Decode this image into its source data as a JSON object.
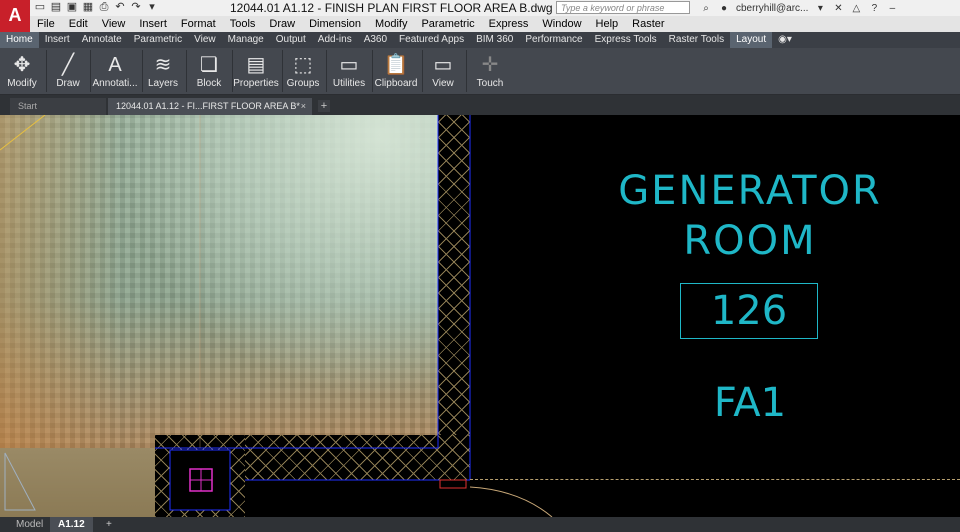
{
  "app": {
    "logo": "A",
    "title": "12044.01 A1.12 - FINISH PLAN FIRST FLOOR AREA B.dwg",
    "search_placeholder": "Type a keyword or phrase",
    "user": "cberryhill@arc..."
  },
  "menu": [
    "File",
    "Edit",
    "View",
    "Insert",
    "Format",
    "Tools",
    "Draw",
    "Dimension",
    "Modify",
    "Parametric",
    "Express",
    "Window",
    "Help",
    "Raster"
  ],
  "ribbon_tabs": [
    "Home",
    "Insert",
    "Annotate",
    "Parametric",
    "View",
    "Manage",
    "Output",
    "Add-ins",
    "A360",
    "Featured Apps",
    "BIM 360",
    "Performance",
    "Express Tools",
    "Raster Tools",
    "Layout"
  ],
  "ribbon_panels": [
    "Modify",
    "Draw",
    "Annotati...",
    "Layers",
    "Block",
    "Properties",
    "Groups",
    "Utilities",
    "Clipboard",
    "View",
    "Touch"
  ],
  "doc_tabs": {
    "start": "Start",
    "file": "12044.01 A1.12 - FI...FIRST FLOOR AREA B*",
    "close": "×",
    "new": "+"
  },
  "drawing": {
    "room_name_line1": "GENERATOR",
    "room_name_line2": "ROOM",
    "room_number": "126",
    "room_code": "FA1"
  },
  "layout_tabs": {
    "model": "Model",
    "layout": "A1.12",
    "new": "+"
  },
  "colors": {
    "room_text": "#1fb7c7",
    "accent_red": "#c8202a",
    "magenta_marker": "#e030c8"
  }
}
